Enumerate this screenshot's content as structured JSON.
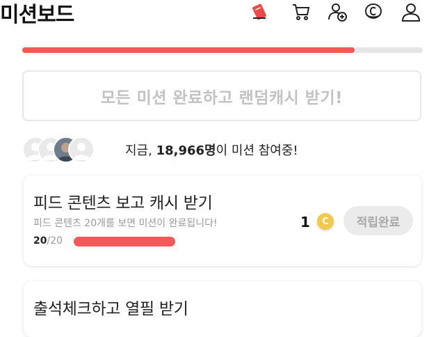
{
  "header": {
    "title": "미션보드",
    "icons": [
      "ticket-icon",
      "cart-icon",
      "add-friend-icon",
      "coin-icon",
      "profile-icon"
    ]
  },
  "overall_progress": {
    "fraction": 0.83,
    "color": "#f25a5a"
  },
  "reward_button": {
    "label": "모든 미션 완료하고 랜덤캐시 받기!"
  },
  "participants": {
    "prefix": "지금, ",
    "count": "18,966명",
    "suffix": "이 미션 참여중!"
  },
  "missions": [
    {
      "title": "피드 콘텐츠 보고 캐시 받기",
      "description": "피드 콘텐츠 20개를 보면 미션이 완료됩니다!",
      "progress_current": "20",
      "progress_total": "/20",
      "progress_fraction": 1.0,
      "reward": "1",
      "coin_symbol": "C",
      "status": "적립완료"
    },
    {
      "title": "출석체크하고 열필 받기"
    }
  ],
  "colors": {
    "accent": "#f25a5a",
    "coin": "#f2c94c",
    "muted_text": "#9a9a9a"
  }
}
